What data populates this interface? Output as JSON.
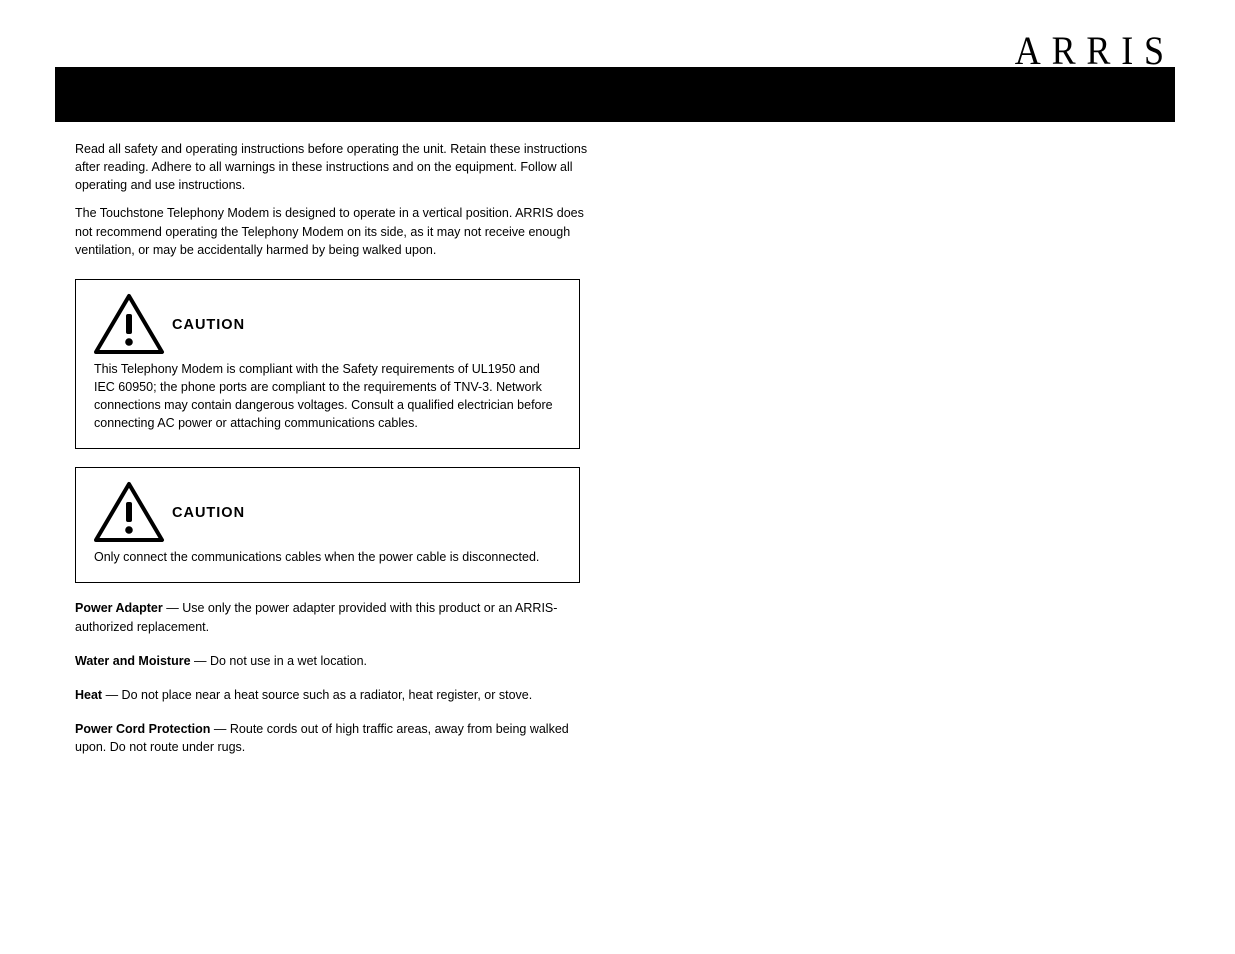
{
  "logo": "ARRIS",
  "intro": [
    "Read all safety and operating instructions before operating the unit. Retain these instructions after reading. Adhere to all warnings in these instructions and on the equipment. Follow all operating and use instructions.",
    "The Touchstone Telephony Modem is designed to operate in a vertical position. ARRIS does not recommend operating the Telephony Modem on its side, as it may not receive enough ventilation, or may be accidentally harmed by being walked upon."
  ],
  "caution1": {
    "label": "CAUTION",
    "text": "This Telephony Modem is compliant with the Safety requirements of UL1950 and IEC 60950; the phone ports are compliant to the requirements of TNV-3. Network connections may contain dangerous voltages. Consult a qualified electrician before connecting AC power or attaching communications cables."
  },
  "caution2": {
    "label": "CAUTION",
    "text": "Only connect the communications cables when the power cable is disconnected."
  },
  "section1": {
    "heading": "Power Adapter",
    "text": "Use only the power adapter provided with this product or an ARRIS-authorized replacement."
  },
  "section2": {
    "heading": "Water and Moisture",
    "text": "Do not use in a wet location."
  },
  "section3": {
    "heading": "Heat",
    "text": "Do not place near a heat source such as a radiator, heat register, or stove."
  },
  "section4": {
    "heading": "Power Cord Protection",
    "text": "Route cords out of high traffic areas, away from being walked upon. Do not route under rugs."
  }
}
